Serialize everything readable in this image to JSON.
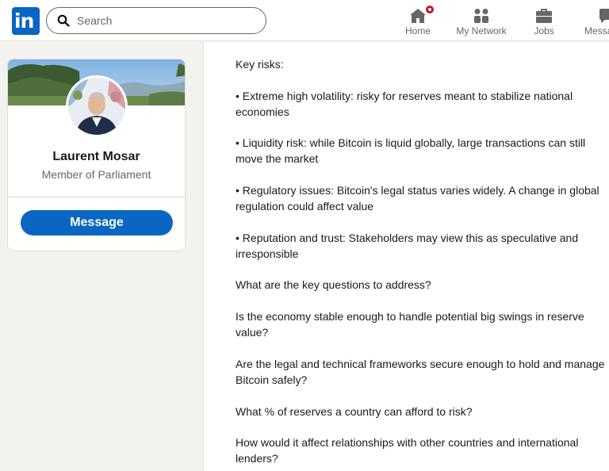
{
  "nav": {
    "logo_text": "in",
    "search_placeholder": "Search",
    "items": [
      {
        "label": "Home",
        "icon": "home-icon",
        "badge": true
      },
      {
        "label": "My Network",
        "icon": "network-icon"
      },
      {
        "label": "Jobs",
        "icon": "briefcase-icon"
      },
      {
        "label": "Messaging",
        "icon": "messaging-icon"
      }
    ]
  },
  "profile": {
    "name": "Laurent Mosar",
    "title": "Member of Parliament",
    "message_label": "Message"
  },
  "post": {
    "paragraphs": [
      "Key risks:",
      "• Extreme high volatility: risky for reserves meant to stabilize national economies",
      "• Liquidity risk: while Bitcoin is liquid globally, large transactions can still move the market",
      "• Regulatory issues: Bitcoin's legal status varies widely. A change in global regulation could affect value",
      "• Reputation and trust: Stakeholders may view this as speculative and irresponsible",
      "What are the key questions to address?",
      "Is the economy stable enough to handle potential big swings in reserve value?",
      "Are the legal and technical frameworks secure enough to hold and manage Bitcoin safely?",
      "What % of reserves a country can afford to risk?",
      "How would it affect relationships with other countries and international lenders?"
    ]
  },
  "colors": {
    "brand": "#0a66c2",
    "notification": "#cb112d",
    "page_background": "#f4f2ee"
  }
}
